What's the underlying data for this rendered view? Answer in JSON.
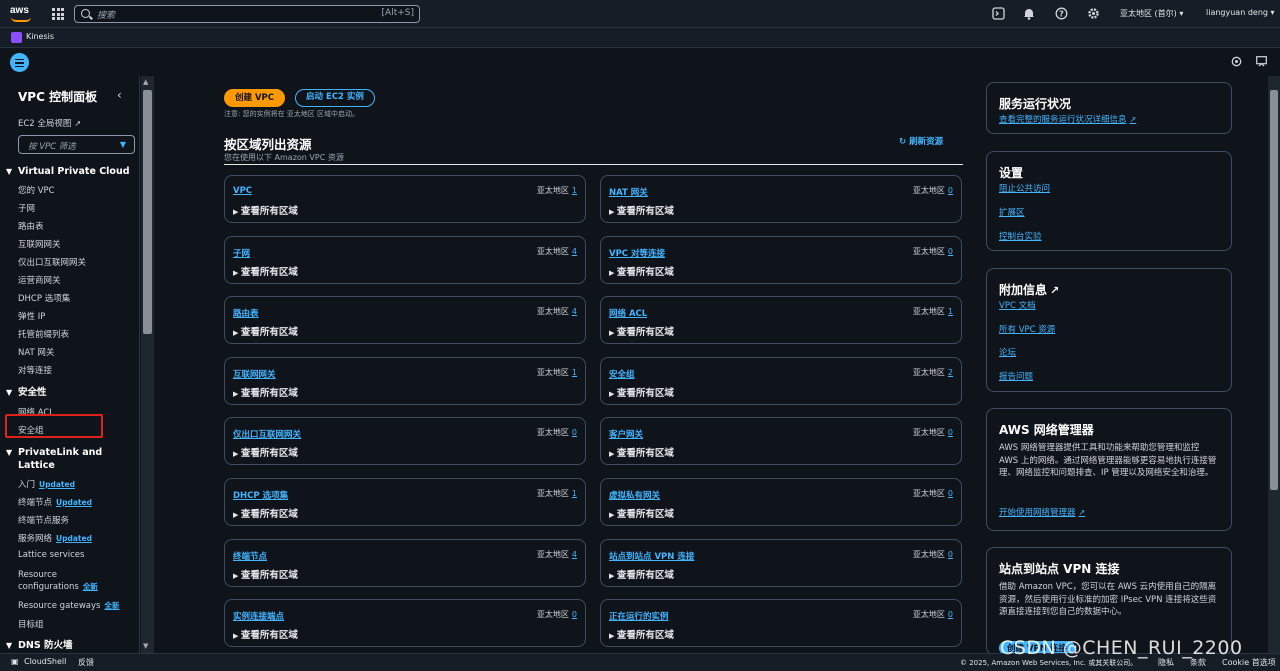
{
  "topnav": {
    "logo": "aws",
    "search_placeholder": "搜索",
    "search_shortcut": "[Alt+S]",
    "region": "亚太地区 (首尔) ▾",
    "user": "liangyuan deng ▾",
    "icons": [
      "cloudshell-icon",
      "bell-icon",
      "help-icon",
      "gear-icon"
    ]
  },
  "service_bar": {
    "service": "Kinesis"
  },
  "sidebar": {
    "title": "VPC 控制面板",
    "ec2_global": "EC2 全局视图",
    "filter_placeholder": "按 VPC 筛选",
    "sections": [
      {
        "title": "Virtual Private Cloud",
        "items": [
          "您的 VPC",
          "子网",
          "路由表",
          "互联网网关",
          "仅出口互联网网关",
          "运营商网关",
          "DHCP 选项集",
          "弹性 IP",
          "托管前缀列表",
          "NAT 网关",
          "对等连接"
        ]
      },
      {
        "title": "安全性",
        "items": [
          "网络 ACL",
          "安全组"
        ]
      },
      {
        "title_line1": "PrivateLink and",
        "title_line2": "Lattice",
        "items": [
          {
            "label": "入门",
            "badge": "Updated"
          },
          {
            "label": "终端节点",
            "badge": "Updated"
          },
          {
            "label": "终端节点服务"
          },
          {
            "label": "服务网络",
            "badge": "Updated"
          },
          {
            "label": "Lattice services"
          },
          {
            "label": "Resource",
            "label2": "configurations",
            "badge": "全新"
          },
          {
            "label": "Resource gateways",
            "badge": "全新"
          },
          {
            "label": "目标组"
          }
        ]
      },
      {
        "title": "DNS 防火墙"
      }
    ]
  },
  "main": {
    "create_vpc": "创建 VPC",
    "launch_ec2": "启动 EC2 实例",
    "note": "注意: 您的实例将在 亚太地区 区域中启动。",
    "resources_title": "按区域列出资源",
    "resources_sub": "您在使用以下 Amazon VPC 资源",
    "refresh": "刷新资源",
    "expand_label": "查看所有区域",
    "region_label": "亚太地区",
    "cards": [
      {
        "name": "VPC",
        "count": "1"
      },
      {
        "name": "NAT 网关",
        "count": "0"
      },
      {
        "name": "子网",
        "count": "4"
      },
      {
        "name": "VPC 对等连接",
        "count": "0"
      },
      {
        "name": "路由表",
        "count": "4"
      },
      {
        "name": "网络 ACL",
        "count": "1"
      },
      {
        "name": "互联网网关",
        "count": "1"
      },
      {
        "name": "安全组",
        "count": "2"
      },
      {
        "name": "仅出口互联网网关",
        "count": "0"
      },
      {
        "name": "客户网关",
        "count": "0"
      },
      {
        "name": "DHCP 选项集",
        "count": "1"
      },
      {
        "name": "虚拟私有网关",
        "count": "0"
      },
      {
        "name": "终端节点",
        "count": "4"
      },
      {
        "name": "站点到站点 VPN 连接",
        "count": "0"
      },
      {
        "name": "实例连接端点",
        "count": "0"
      },
      {
        "name": "正在运行的实例",
        "count": "0"
      }
    ]
  },
  "right": {
    "health_title": "服务运行状况",
    "health_link": "查看完整的服务运行状况详细信息",
    "settings_title": "设置",
    "settings_links": [
      "阻止公共访问",
      "扩展区",
      "控制台实验"
    ],
    "info_title": "附加信息",
    "info_links": [
      "VPC 文档",
      "所有 VPC 资源",
      "论坛",
      "报告问题"
    ],
    "nm_title": "AWS 网络管理器",
    "nm_text": "AWS 网络管理器提供工具和功能来帮助您管理和监控 AWS 上的网络。通过网络管理器能够更容易地执行连接管理、网络监控和问题排查、IP 管理以及网络安全和治理。",
    "nm_link": "开始使用网络管理器",
    "vpn_title": "站点到站点 VPN 连接",
    "vpn_text": "借助 Amazon VPC，您可以在 AWS 云内使用自己的隔离资源，然后使用行业标准的加密 IPsec VPN 连接将这些资源直接连接到您自己的数据中心。",
    "vpn_btn": "创建 VPN 连接"
  },
  "footer": {
    "cloudshell": "CloudShell",
    "feedback": "反馈",
    "copyright": "© 2025, Amazon Web Services, Inc. 或其关联公司。",
    "privacy": "隐私",
    "terms": "条款",
    "cookie": "Cookie 首选项"
  },
  "watermark": "CSDN @CHEN_RUI_2200"
}
